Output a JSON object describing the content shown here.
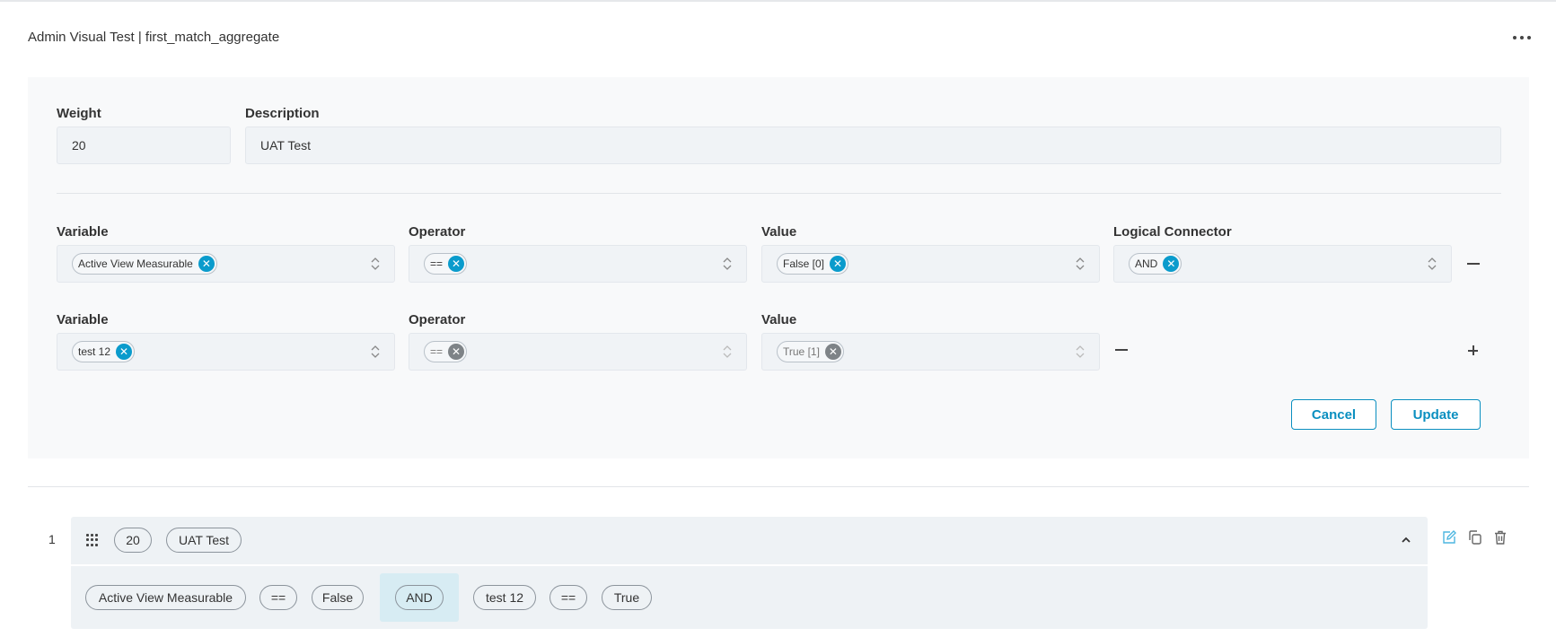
{
  "header": {
    "title": "Admin Visual Test | first_match_aggregate",
    "more_icon": "more-horizontal-icon"
  },
  "editor": {
    "weight_label": "Weight",
    "weight_value": "20",
    "description_label": "Description",
    "description_value": "UAT Test",
    "conditions": [
      {
        "variable_label": "Variable",
        "variable_value": "Active View Measurable",
        "operator_label": "Operator",
        "operator_value": "==",
        "value_label": "Value",
        "value_value": "False [0]",
        "connector_label": "Logical Connector",
        "connector_value": "AND"
      },
      {
        "variable_label": "Variable",
        "variable_value": "test 12",
        "operator_label": "Operator",
        "operator_value": "==",
        "value_label": "Value",
        "value_value": "True [1]"
      }
    ],
    "cancel_label": "Cancel",
    "update_label": "Update"
  },
  "rules": [
    {
      "index": "1",
      "weight": "20",
      "description": "UAT Test",
      "expression": [
        "Active View Measurable",
        "==",
        "False",
        "AND",
        "test 12",
        "==",
        "True"
      ]
    }
  ],
  "colors": {
    "accent": "#0a9bcc",
    "panel": "#f8f9fa",
    "field": "#f0f3f6",
    "highlight": "#d7ecf3"
  }
}
